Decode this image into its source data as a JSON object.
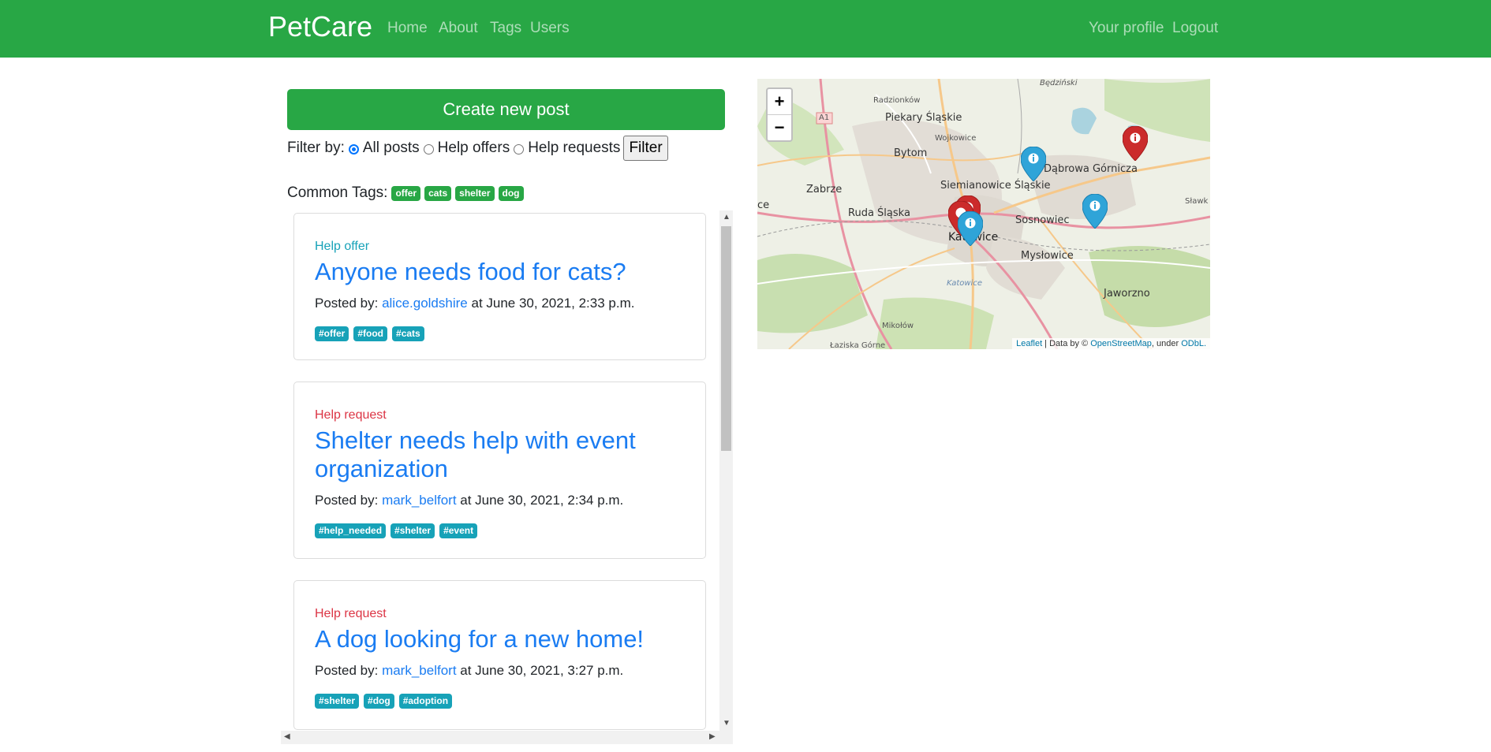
{
  "navbar": {
    "brand": "PetCare",
    "links": [
      "Home",
      "About",
      "Tags",
      "Users"
    ],
    "right_links": [
      "Your profile",
      "Logout"
    ],
    "bg_color": "#28a745"
  },
  "create_button": "Create new post",
  "filter": {
    "label": "Filter by:",
    "options": [
      "All posts",
      "Help offers",
      "Help requests"
    ],
    "selected": "All posts",
    "button": "Filter"
  },
  "common_tags": {
    "label": "Common Tags:",
    "tags": [
      "offer",
      "cats",
      "shelter",
      "dog"
    ]
  },
  "posts": [
    {
      "type": "Help offer",
      "type_color": "#17a2b8",
      "title": "Anyone needs food for cats?",
      "posted_prefix": "Posted by:",
      "user": "alice.goldshire",
      "date": "at June 30, 2021, 2:33 p.m.",
      "tags": [
        "#offer",
        "#food",
        "#cats"
      ]
    },
    {
      "type": "Help request",
      "type_color": "#dc3545",
      "title": "Shelter needs help with event organization",
      "posted_prefix": "Posted by:",
      "user": "mark_belfort",
      "date": "at June 30, 2021, 2:34 p.m.",
      "tags": [
        "#help_needed",
        "#shelter",
        "#event"
      ]
    },
    {
      "type": "Help request",
      "type_color": "#dc3545",
      "title": "A dog looking for a new home!",
      "posted_prefix": "Posted by:",
      "user": "mark_belfort",
      "date": "at June 30, 2021, 3:27 p.m.",
      "tags": [
        "#shelter",
        "#dog",
        "#adoption"
      ]
    }
  ],
  "map": {
    "zoom_in": "+",
    "zoom_out": "−",
    "attribution": {
      "leaflet": "Leaflet",
      "sep": " | Data by © ",
      "osm": "OpenStreetMap",
      "under": ", under ",
      "odbl": "ODbL."
    },
    "places": [
      "Radzionków",
      "Piekary Śląskie",
      "Wojkowice",
      "Bytom",
      "Zabrze",
      "Siemianowice Śląskie",
      "Dąbrowa Górnicza",
      "Ruda Śląska",
      "Sosnowiec",
      "Katowice",
      "Mysłowice",
      "Jaworzno",
      "Mikołów",
      "Łaziska Górne",
      "Sławk",
      "ce",
      "Będziński",
      "A1",
      "Katowice"
    ],
    "marker_colors": {
      "offer": "#2fa4d8",
      "request": "#cb2b2b"
    }
  }
}
